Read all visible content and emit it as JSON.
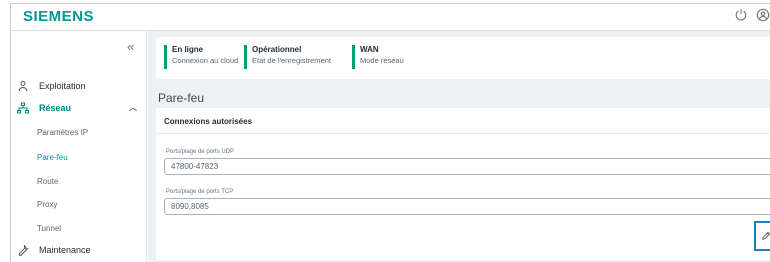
{
  "brand": {
    "logo_text": "SIEMENS",
    "color": "#009999"
  },
  "header": {
    "icons": [
      "power-icon",
      "user-icon"
    ]
  },
  "sidebar": {
    "collapse_glyph": "«",
    "items": [
      {
        "label": "Exploitation",
        "icon": "exploitation-icon"
      },
      {
        "label": "Réseau",
        "icon": "network-icon",
        "expanded": true,
        "children": [
          "Paramètres IP",
          "Pare-feu",
          "Route",
          "Proxy",
          "Tunnel"
        ],
        "active_child": "Pare-feu"
      },
      {
        "label": "Maintenance",
        "icon": "wrench-icon"
      }
    ]
  },
  "status": [
    {
      "title": "En ligne",
      "subtitle": "Connexion au cloud"
    },
    {
      "title": "Opérationnel",
      "subtitle": "Etat de l'enregistrement"
    },
    {
      "title": "WAN",
      "subtitle": "Mode réseau"
    }
  ],
  "page": {
    "title": "Pare-feu",
    "panel_title": "Connexions autorisées",
    "udp_label": "Ports/plage de ports UDP",
    "udp_value": "47800-47823",
    "tcp_label": "Ports/plage de ports TCP",
    "tcp_value": "8090,8085"
  },
  "colors": {
    "accent": "#009999",
    "status_bar": "#00a070",
    "focus": "#1a7fc4"
  }
}
